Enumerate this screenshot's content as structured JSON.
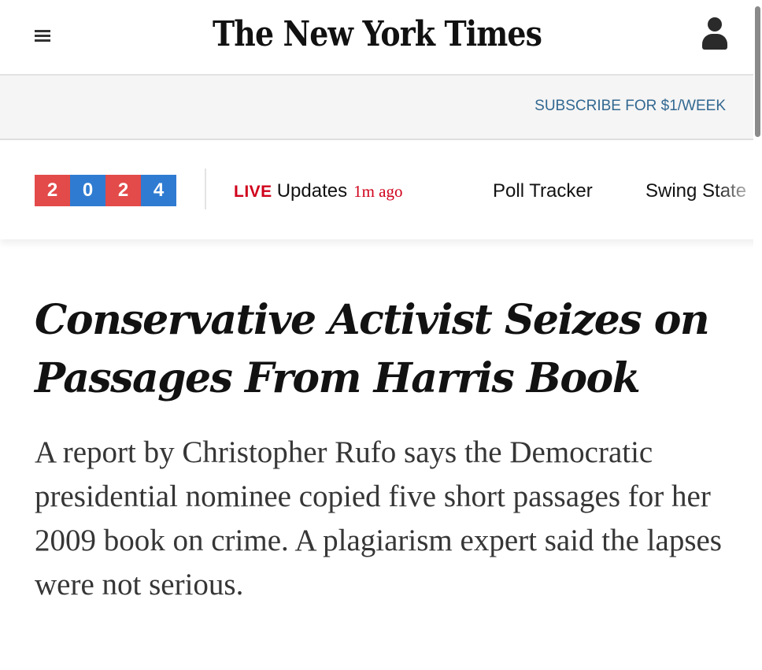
{
  "masthead": {
    "logo_text": "The New York Times",
    "menu_icon": "hamburger-menu-icon",
    "account_icon": "user-account-icon"
  },
  "subscribe": {
    "label": "SUBSCRIBE FOR $1/WEEK",
    "color": "#326891"
  },
  "election_nav": {
    "year_digits": [
      "2",
      "0",
      "2",
      "4"
    ],
    "year_colors": [
      "#e34a4a",
      "#2f7bd1",
      "#e34a4a",
      "#2f7bd1"
    ],
    "live_label": "LIVE",
    "live_text": "Updates",
    "live_time": "1m ago",
    "links": [
      "Poll Tracker",
      "Swing State"
    ]
  },
  "article": {
    "headline": "Conservative Activist Seizes on Passages From Harris Book",
    "summary": "A report by Christopher Rufo says the Democratic presidential nominee copied five short passages for her 2009 book on crime. A plagiarism expert said the lapses were not serious."
  },
  "colors": {
    "live_red": "#d0021b",
    "text": "#121212",
    "summary_text": "#363636"
  }
}
